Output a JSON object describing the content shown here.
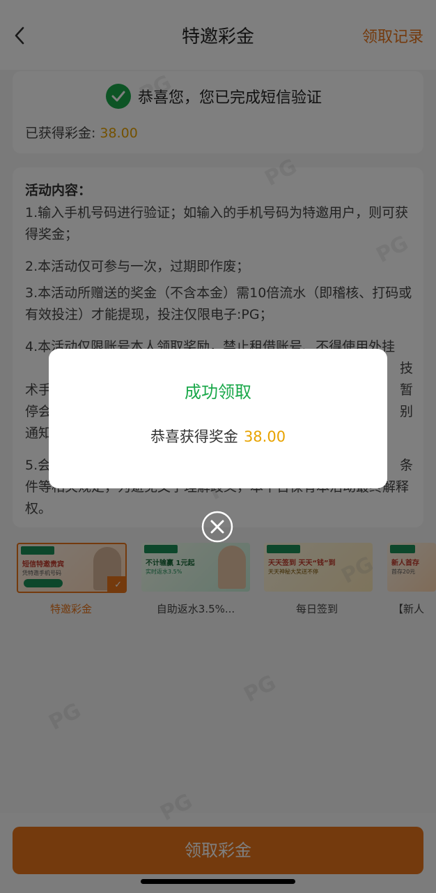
{
  "header": {
    "title": "特邀彩金",
    "records_label": "领取记录"
  },
  "status": {
    "message": "恭喜您，您已完成短信验证",
    "earned_label": "已获得彩金:",
    "earned_amount": "38.00"
  },
  "activity": {
    "title": "活动内容：",
    "rules": [
      "1.输入手机号码进行验证；如输入的手机号码为特邀用户，则可获得奖金；",
      "2.本活动仅可参与一次，过期即作废；",
      "3.本活动所赠送的奖金（不含本金）需10倍流水（即稽核、打码或有效投注）才能提现，投注仅限电子:PG；",
      "4.本活动仅限账号本人领取奖励，禁止租借账号、不得使用外挂",
      "5.会",
      "件等相关规定，为避免文字理解歧义，本平台保有本活动最终解释权。"
    ],
    "rule4_line2_end": "技",
    "rule4_line3_start": "术手",
    "rule4_line3_end": "暂",
    "rule4_line4_start": "停会",
    "rule4_line4_end": "别",
    "rule4_line5_start": "通知",
    "rule5_line1_end": "条"
  },
  "banners": [
    {
      "label": "特邀彩金",
      "t1": "短信特邀贵宾",
      "t2": "凭特邀手机号码",
      "selected": true
    },
    {
      "label": "自助返水3.5%...",
      "t1": "不计输赢 1元起",
      "t2": "实时返水3.5%",
      "selected": false
    },
    {
      "label": "每日签到",
      "t1": "天天签到 天天“钱”到",
      "t2": "天天神秘大奖送不停",
      "selected": false
    },
    {
      "label": "【新人",
      "t1": "新人首存",
      "t2": "首存20元",
      "selected": false
    }
  ],
  "bottom": {
    "claim_label": "领取彩金"
  },
  "modal": {
    "title": "成功领取",
    "message": "恭喜获得奖金",
    "amount": "38.00"
  },
  "icons": {
    "back": "chevron-left-icon",
    "check": "check-circle-icon",
    "close": "close-circle-icon"
  },
  "colors": {
    "accent": "#e8751a",
    "success": "#1aa84a",
    "amount": "#e8a300"
  }
}
